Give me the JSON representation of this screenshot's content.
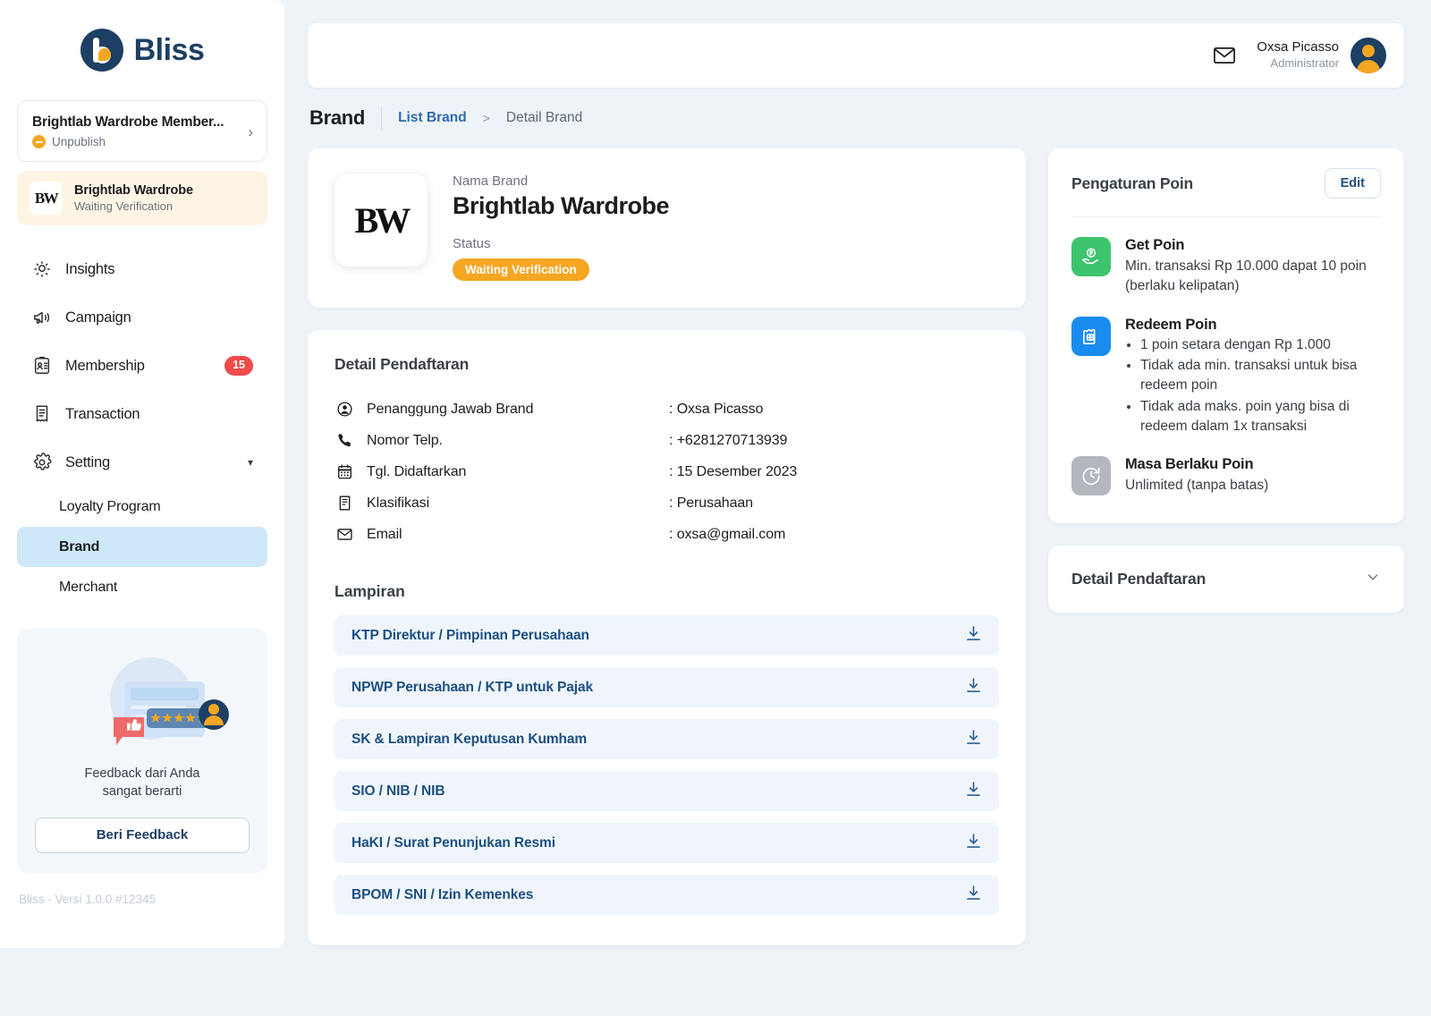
{
  "app": {
    "name": "Bliss",
    "version_text": "Bliss - Versi 1.0.0 #12345"
  },
  "sidebar": {
    "brand_switch": {
      "title": "Brightlab Wardrobe Member...",
      "status": "Unpublish",
      "chevron": "chevron-right-icon"
    },
    "brand_active": {
      "monogram": "BW",
      "title": "Brightlab Wardrobe",
      "status": "Waiting Verification"
    },
    "nav": [
      {
        "label": "Insights",
        "icon": "insights-icon",
        "badge": ""
      },
      {
        "label": "Campaign",
        "icon": "megaphone-icon",
        "badge": ""
      },
      {
        "label": "Membership",
        "icon": "id-card-icon",
        "badge": "15"
      },
      {
        "label": "Transaction",
        "icon": "receipt-icon",
        "badge": ""
      },
      {
        "label": "Setting",
        "icon": "gear-icon",
        "badge": ""
      }
    ],
    "sub_nav": [
      {
        "label": "Loyalty Program",
        "active": false
      },
      {
        "label": "Brand",
        "active": true
      },
      {
        "label": "Merchant",
        "active": false
      }
    ],
    "feedback": {
      "caption_line1": "Feedback dari Anda",
      "caption_line2": "sangat berarti",
      "button": "Beri Feedback"
    }
  },
  "topbar": {
    "mail_icon": "mail-icon",
    "user_name": "Oxsa Picasso",
    "user_role": "Administrator"
  },
  "breadcrumb": {
    "title": "Brand",
    "link": "List Brand",
    "separator": ">",
    "current": "Detail Brand"
  },
  "brand_card": {
    "monogram": "BW",
    "name_label": "Nama Brand",
    "name": "Brightlab Wardrobe",
    "status_label": "Status",
    "status_value": "Waiting Verification"
  },
  "detail": {
    "title": "Detail Pendaftaran",
    "rows": [
      {
        "icon": "person-circle-icon",
        "label": "Penanggung Jawab Brand",
        "value": ": Oxsa Picasso"
      },
      {
        "icon": "phone-icon",
        "label": "Nomor Telp.",
        "value": ": +6281270713939"
      },
      {
        "icon": "calendar-icon",
        "label": "Tgl. Didaftarkan",
        "value": ": 15 Desember 2023"
      },
      {
        "icon": "document-icon",
        "label": "Klasifikasi",
        "value": ": Perusahaan"
      },
      {
        "icon": "mail-icon",
        "label": "Email",
        "value": ": oxsa@gmail.com"
      }
    ],
    "attachments_title": "Lampiran",
    "attachments": [
      {
        "name": "KTP Direktur / Pimpinan Perusahaan",
        "action": "download-icon"
      },
      {
        "name": "NPWP Perusahaan / KTP untuk Pajak",
        "action": "download-icon"
      },
      {
        "name": "SK & Lampiran Keputusan Kumham",
        "action": "download-icon"
      },
      {
        "name": "SIO / NIB / NIB",
        "action": "download-icon"
      },
      {
        "name": "HaKI / Surat Penunjukan Resmi",
        "action": "download-icon"
      },
      {
        "name": "BPOM / SNI / Izin Kemenkes",
        "action": "download-icon"
      }
    ]
  },
  "points": {
    "title": "Pengaturan Poin",
    "edit_label": "Edit",
    "get_poin": {
      "icon": "hand-coin-icon",
      "color": "#3ec46d",
      "name": "Get Poin",
      "desc": "Min. transaksi Rp 10.000 dapat 10 poin (berlaku kelipatan)"
    },
    "redeem_poin": {
      "icon": "gift-icon",
      "color": "#1a8cf0",
      "name": "Redeem Poin",
      "bullets": [
        "1 poin setara dengan Rp 1.000",
        "Tidak ada min. transaksi untuk bisa redeem poin",
        "Tidak ada maks. poin yang bisa di redeem dalam 1x transaksi"
      ]
    },
    "masa_berlaku": {
      "icon": "clock-refresh-icon",
      "color": "#b3b8bf",
      "name": "Masa Berlaku Poin",
      "desc": "Unlimited (tanpa batas)"
    }
  },
  "detail_panel": {
    "title": "Detail Pendaftaran",
    "chevron": "chevron-down-icon"
  }
}
